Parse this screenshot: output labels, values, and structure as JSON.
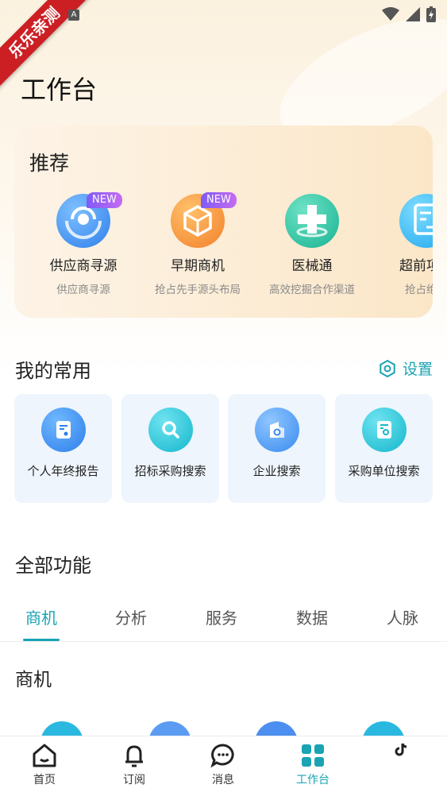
{
  "status_bar": {
    "ribbon_text": "乐乐亲测",
    "notification_badge": "A",
    "icons": [
      "wifi-icon",
      "signal-icon",
      "battery-charging-icon"
    ]
  },
  "page": {
    "title": "工作台"
  },
  "recommend": {
    "title": "推荐",
    "items": [
      {
        "name": "供应商寻源",
        "desc": "供应商寻源",
        "badge": "NEW",
        "icon": "radar-icon",
        "color": "#3b8cf0"
      },
      {
        "name": "早期商机",
        "desc": "抢占先手源头布局",
        "badge": "NEW",
        "icon": "cube-icon",
        "color": "#f7962f"
      },
      {
        "name": "医械通",
        "desc": "高效挖掘合作渠道",
        "badge": "",
        "icon": "medical-cross-icon",
        "color": "#26c3a4"
      },
      {
        "name": "超前项目",
        "desc": "抢占绝对",
        "badge": "",
        "icon": "document-arrow-icon",
        "color": "#34b8f2"
      }
    ]
  },
  "favorites": {
    "title": "我的常用",
    "settings_label": "设置",
    "items": [
      {
        "label": "个人年终报告",
        "icon": "report-icon"
      },
      {
        "label": "招标采购搜索",
        "icon": "search-icon"
      },
      {
        "label": "企业搜索",
        "icon": "company-search-icon"
      },
      {
        "label": "采购单位搜索",
        "icon": "buyer-search-icon"
      }
    ]
  },
  "all_functions": {
    "title": "全部功能",
    "tabs": [
      {
        "label": "商机",
        "active": true
      },
      {
        "label": "分析",
        "active": false
      },
      {
        "label": "服务",
        "active": false
      },
      {
        "label": "数据",
        "active": false
      },
      {
        "label": "人脉",
        "active": false
      }
    ],
    "section_title": "商机"
  },
  "bottom_nav": {
    "items": [
      {
        "label": "首页",
        "icon": "home-icon",
        "active": false
      },
      {
        "label": "订阅",
        "icon": "bell-icon",
        "active": false
      },
      {
        "label": "消息",
        "icon": "chat-icon",
        "active": false
      },
      {
        "label": "工作台",
        "icon": "grid-icon",
        "active": true
      },
      {
        "label": "",
        "icon": "tiktok-icon",
        "active": false
      }
    ]
  },
  "colors": {
    "accent": "#1aa3b3",
    "ribbon": "#cc1f24"
  }
}
